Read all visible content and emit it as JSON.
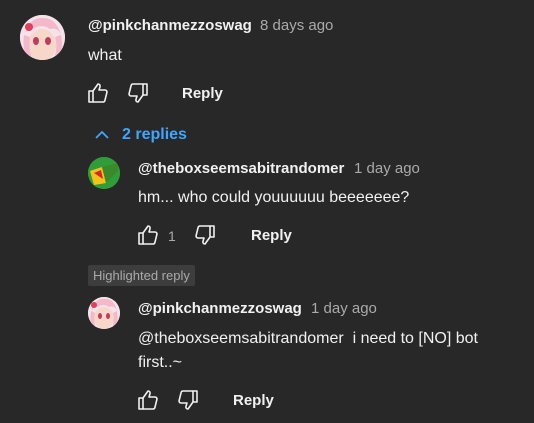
{
  "comment": {
    "author": "@pinkchanmezzoswag",
    "time": "8 days ago",
    "text": "what",
    "reply_label": "Reply",
    "replies_toggle_label": "2 replies"
  },
  "replies": [
    {
      "author": "@theboxseemsabitrandomer",
      "time": "1 day ago",
      "text": "hm... who could youuuuuu beeeeeee?",
      "like_count": "1",
      "reply_label": "Reply"
    },
    {
      "badge": "Highlighted reply",
      "author": "@pinkchanmezzoswag",
      "time": "1 day ago",
      "text_line1": "@theboxseemsabitrandomer  i need to [NO] bot",
      "text_line2": "first..~",
      "reply_label": "Reply"
    }
  ],
  "icons": {
    "like": "thumbs-up-icon",
    "dislike": "thumbs-down-icon",
    "collapse": "chevron-up-icon"
  },
  "colors": {
    "background": "#282828",
    "link": "#3ea6ff",
    "secondary_text": "#aaaaaa"
  }
}
